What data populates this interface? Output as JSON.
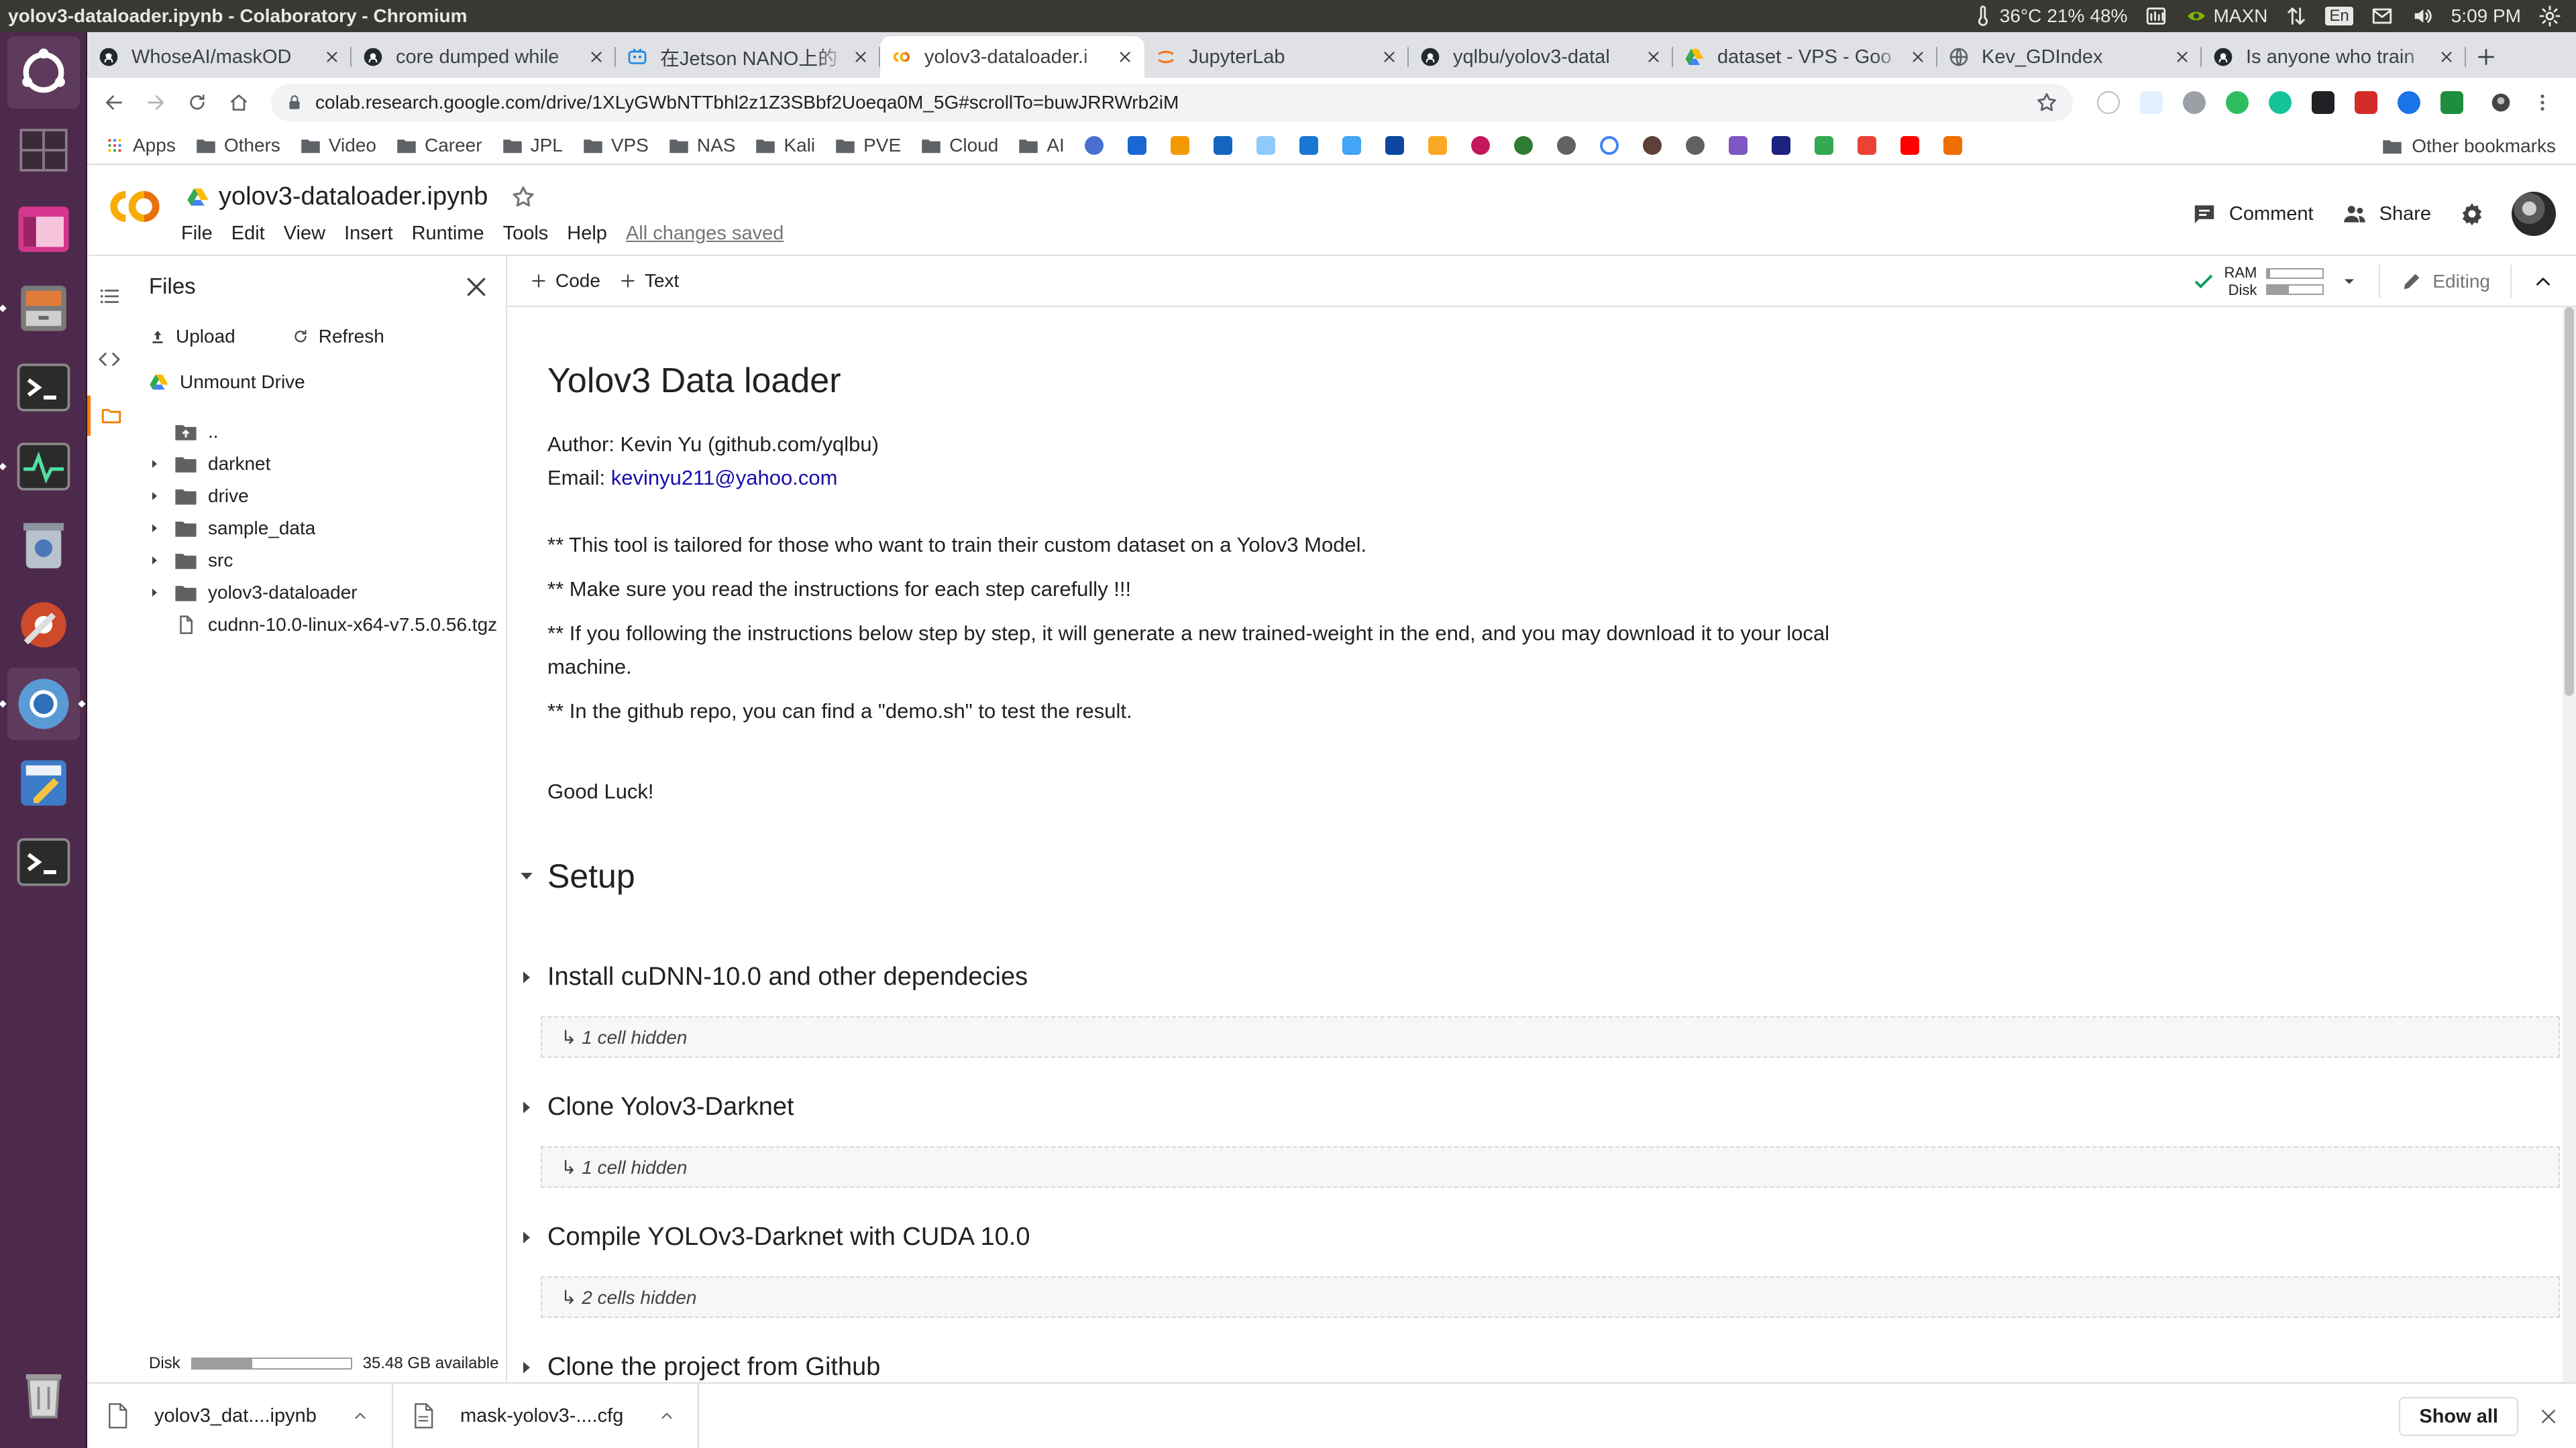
{
  "system": {
    "window_title": "yolov3-dataloader.ipynb - Colaboratory - Chromium",
    "temperature": "36°C",
    "cpu": "21%",
    "battery": "48%",
    "power_mode": "MAXN",
    "lang": "En",
    "time": "5:09 PM"
  },
  "tabs": [
    {
      "title": "WhoseAI/maskOD",
      "icon": "github-icon",
      "active": false
    },
    {
      "title": "core dumped while",
      "icon": "github-icon",
      "active": false
    },
    {
      "title": "在Jetson NANO上的",
      "icon": "robot-icon",
      "active": false
    },
    {
      "title": "yolov3-dataloader.i",
      "icon": "colab-icon",
      "active": true
    },
    {
      "title": "JupyterLab",
      "icon": "jupyter-icon",
      "active": false
    },
    {
      "title": "yqlbu/yolov3-datal",
      "icon": "github-icon",
      "active": false
    },
    {
      "title": "dataset - VPS - Goo",
      "icon": "drive-icon",
      "active": false
    },
    {
      "title": "Kev_GDIndex",
      "icon": "globe-icon",
      "active": false
    },
    {
      "title": "Is anyone who train",
      "icon": "github-icon",
      "active": false
    }
  ],
  "omnibox": {
    "url": "colab.research.google.com/drive/1XLyGWbNTTbhl2z1Z3SBbf2Uoeqa0M_5G#scrollTo=buwJRRWrb2iM"
  },
  "bookmarks": {
    "apps": "Apps",
    "folders": [
      "Others",
      "Video",
      "Career",
      "JPL",
      "VPS",
      "NAS",
      "Kali",
      "PVE",
      "Cloud",
      "AI"
    ],
    "other": "Other bookmarks"
  },
  "colab": {
    "notebook_name": "yolov3-dataloader.ipynb",
    "menus": [
      "File",
      "Edit",
      "View",
      "Insert",
      "Runtime",
      "Tools",
      "Help"
    ],
    "save_status": "All changes saved",
    "comment": "Comment",
    "share": "Share"
  },
  "files_pane": {
    "title": "Files",
    "upload": "Upload",
    "refresh": "Refresh",
    "unmount": "Unmount Drive",
    "tree": [
      {
        "name": "..",
        "type": "up"
      },
      {
        "name": "darknet",
        "type": "folder"
      },
      {
        "name": "drive",
        "type": "folder"
      },
      {
        "name": "sample_data",
        "type": "folder"
      },
      {
        "name": "src",
        "type": "folder"
      },
      {
        "name": "yolov3-dataloader",
        "type": "folder"
      },
      {
        "name": "cudnn-10.0-linux-x64-v7.5.0.56.tgz",
        "type": "file"
      }
    ],
    "disk_label": "Disk",
    "disk_available": "35.48 GB available",
    "disk_used_fraction": 0.38
  },
  "nb_toolbar": {
    "add_code": "Code",
    "add_text": "Text",
    "ram_label": "RAM",
    "disk_label": "Disk",
    "ram_fraction": 0.05,
    "disk_fraction": 0.38,
    "mode": "Editing"
  },
  "notebook": {
    "title": "Yolov3 Data loader",
    "author": "Author: Kevin Yu (github.com/yqlbu)",
    "email_label": "Email: ",
    "email": "kevinyu211@yahoo.com",
    "notes": [
      "** This tool is tailored for those who want to train their custom dataset on a Yolov3 Model.",
      "** Make sure you read the instructions for each step carefully !!!",
      "** If you following the instructions below step by step, it will generate a new trained-weight in the end, and you may download it to your local",
      "machine.",
      "** In the github repo, you can find a \"demo.sh\" to test the result."
    ],
    "good_luck": "Good Luck!",
    "section": "Setup",
    "subsections": [
      {
        "title": "Install cuDNN-10.0 and other dependecies",
        "hidden": "↳ 1 cell hidden"
      },
      {
        "title": "Clone Yolov3-Darknet",
        "hidden": "↳ 1 cell hidden"
      },
      {
        "title": "Compile YOLOv3-Darknet with CUDA 10.0",
        "hidden": "↳ 2 cells hidden"
      },
      {
        "title": "Clone the project from Github",
        "hidden": ""
      }
    ]
  },
  "downloads": [
    {
      "name": "yolov3_dat....ipynb"
    },
    {
      "name": "mask-yolov3-....cfg"
    }
  ],
  "shelf": {
    "show_all": "Show all"
  }
}
